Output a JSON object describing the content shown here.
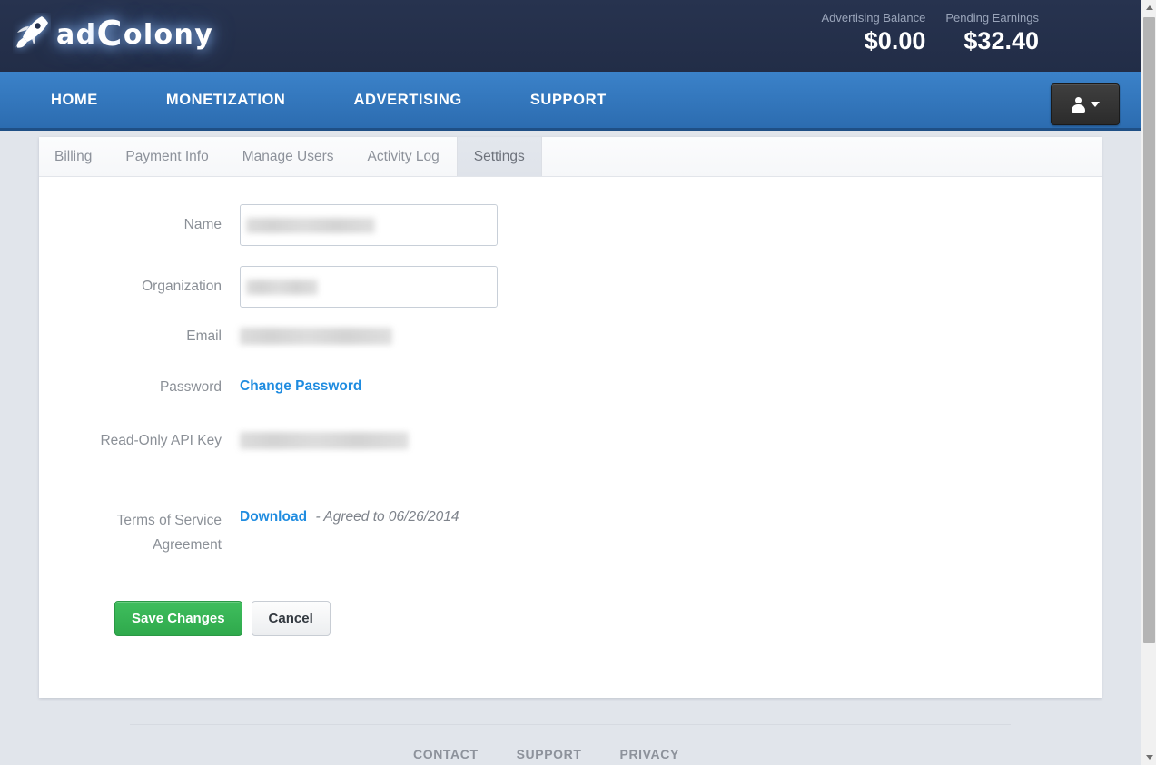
{
  "brand": {
    "name_lead": "ad",
    "name_rest": "olony",
    "name_cap": "C",
    "logo_icon": "rocket-icon",
    "glow_color": "#8fc2ff",
    "header_bg": "#25314d"
  },
  "header": {
    "balances": [
      {
        "label": "Advertising Balance",
        "value": "$0.00"
      },
      {
        "label": "Pending Earnings",
        "value": "$32.40"
      }
    ],
    "user_menu": {
      "icon": "user-icon",
      "caret": "chevron-down-icon"
    }
  },
  "nav": {
    "accent": "#2c6cb0",
    "items": [
      {
        "label": "HOME"
      },
      {
        "label": "MONETIZATION"
      },
      {
        "label": "ADVERTISING"
      },
      {
        "label": "SUPPORT"
      }
    ]
  },
  "tabs": [
    {
      "label": "Billing",
      "active": false
    },
    {
      "label": "Payment Info",
      "active": false
    },
    {
      "label": "Manage Users",
      "active": false
    },
    {
      "label": "Activity Log",
      "active": false
    },
    {
      "label": "Settings",
      "active": true
    }
  ],
  "form": {
    "name": {
      "label": "Name",
      "value": "",
      "redacted": true,
      "redact_width": 142
    },
    "organization": {
      "label": "Organization",
      "value": "",
      "redacted": true,
      "redact_width": 79
    },
    "email": {
      "label": "Email",
      "value": "",
      "redacted": true,
      "redact_width": 168
    },
    "password": {
      "label": "Password",
      "action_label": "Change Password",
      "link_color": "#1f8ce0"
    },
    "api_key": {
      "label": "Read-Only API Key",
      "value": "",
      "redacted": true,
      "redact_width": 186
    },
    "tos": {
      "label_line1": "Terms of Service",
      "label_line2": "Agreement",
      "download_label": "Download",
      "agreed_text": "- Agreed to 06/26/2014"
    },
    "buttons": {
      "save_label": "Save Changes",
      "cancel_label": "Cancel",
      "save_color": "#32ab4f"
    }
  },
  "footer": {
    "links": [
      {
        "label": "CONTACT"
      },
      {
        "label": "SUPPORT"
      },
      {
        "label": "PRIVACY"
      }
    ]
  },
  "scrollbar": {
    "up_icon": "scroll-up-arrow-icon",
    "down_icon": "scroll-down-arrow-icon"
  }
}
